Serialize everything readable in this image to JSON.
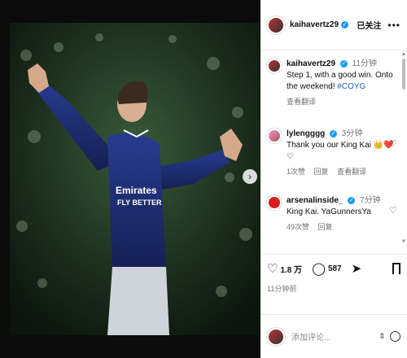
{
  "post": {
    "author": "kaihavertz29",
    "follow_label": "已关注",
    "more_label": "•••"
  },
  "caption": {
    "user": "kaihavertz29",
    "time": "11分钟",
    "text": "Step 1, with a good win. Onto the weekend!",
    "hashtag": "#COYG",
    "translate": "查看翻译"
  },
  "comments": [
    {
      "user": "lylengggg",
      "time": "3分钟",
      "text": "Thank you our King Kai",
      "emojis": "👑❤️♡",
      "likes": "1次赞",
      "reply": "回复",
      "translate": "查看翻译"
    },
    {
      "user": "arsenalinside_",
      "time": "7分钟",
      "text": "King Kai. YaGunnersYa",
      "likes": "49次赞",
      "reply": "回复"
    }
  ],
  "actions": {
    "likes": "1.8 万",
    "comments": "587",
    "posted": "11分钟前"
  },
  "add_comment": {
    "placeholder": "添加评论..."
  },
  "icons": {
    "like": "heart-icon",
    "comment": "comment-icon",
    "share": "share-icon",
    "save": "bookmark-icon",
    "next": "chevron-right-icon",
    "emoji": "emoji-icon"
  },
  "colors": {
    "link": "#1d5fb2",
    "verified": "#1d9bf0",
    "kit_navy": "#1a2a6c"
  }
}
